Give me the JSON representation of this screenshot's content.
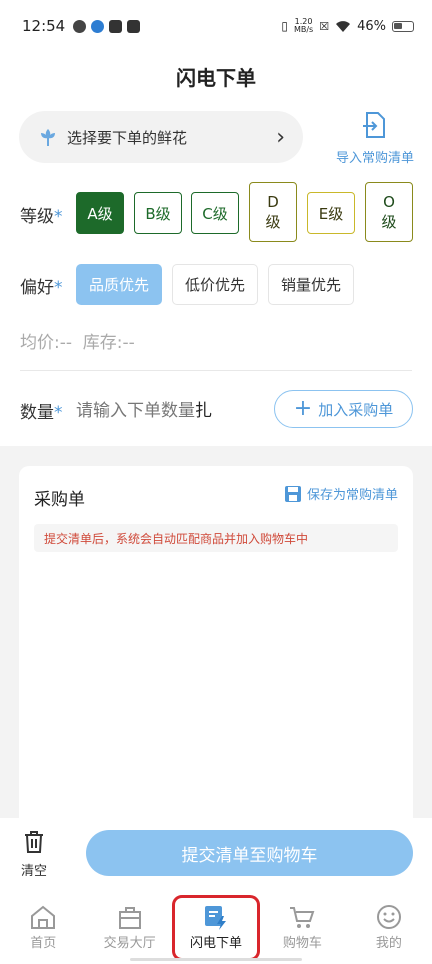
{
  "status_bar": {
    "time": "12:54",
    "net_speed_value": "1.20",
    "net_speed_unit": "MB/s",
    "battery_percent": "46%",
    "battery_level": 0.46
  },
  "page": {
    "title": "闪电下单"
  },
  "flower_select": {
    "label": "选择要下单的鲜花"
  },
  "import_button": {
    "label": "导入常购清单"
  },
  "grade": {
    "label": "等级",
    "required_mark": "*",
    "options": [
      "A级",
      "B级",
      "C级",
      "D级",
      "E级",
      "O级"
    ],
    "selected": "A级"
  },
  "preference": {
    "label": "偏好",
    "required_mark": "*",
    "options": [
      "品质优先",
      "低价优先",
      "销量优先"
    ],
    "selected": "品质优先"
  },
  "price_info": {
    "text": "均价:--  库存:--"
  },
  "quantity": {
    "label": "数量",
    "required_mark": "*",
    "placeholder": "请输入下单数量",
    "unit": "扎",
    "add_button": "加入采购单"
  },
  "order": {
    "title": "采购单",
    "save_button": "保存为常购清单",
    "notice": "提交清单后，系统会自动匹配商品并加入购物车中"
  },
  "action": {
    "clear_label": "清空",
    "submit_label": "提交清单至购物车"
  },
  "tabs": [
    {
      "label": "首页",
      "icon": "home-icon"
    },
    {
      "label": "交易大厅",
      "icon": "bag-icon"
    },
    {
      "label": "闪电下单",
      "icon": "flash-order-icon"
    },
    {
      "label": "购物车",
      "icon": "cart-icon"
    },
    {
      "label": "我的",
      "icon": "smile-icon"
    }
  ],
  "active_tab": "闪电下单",
  "colors": {
    "accent_blue": "#4e97d8",
    "light_blue": "#8cc3f0",
    "grade_green": "#1d6a2a",
    "grade_olive": "#8a8a1c",
    "highlight_red": "#d9262c",
    "notice_red": "#d04a3a"
  }
}
